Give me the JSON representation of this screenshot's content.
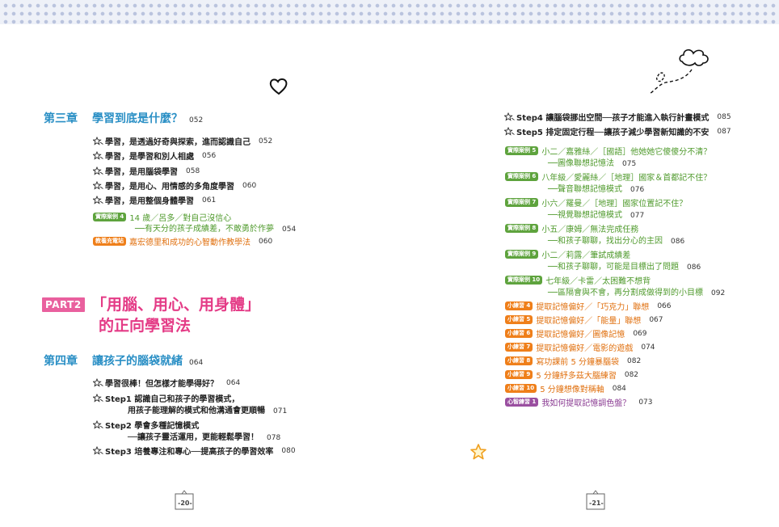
{
  "part": {
    "badge": "PART2",
    "title_line1": "「用腦、用心、用身體」",
    "title_line2": "的正向學習法"
  },
  "ch3": {
    "num": "第三章",
    "title": "學習到底是什麼？",
    "page": "052",
    "items": [
      {
        "text": "學習，是透過好奇與探索，進而認識自己",
        "page": "052"
      },
      {
        "text": "學習，是學習和別人相處",
        "page": "056"
      },
      {
        "text": "學習，是用腦袋學習",
        "page": "058"
      },
      {
        "text": "學習，是用心、用情感的多角度學習",
        "page": "060"
      },
      {
        "text": "學習，是用整個身體學習",
        "page": "061"
      }
    ],
    "case4": {
      "tag": "實際案例 4",
      "title": "14 歲／呂多／對自己沒信心",
      "sub": "──有天分的孩子成績差，不敢勇於作夢",
      "page": "054"
    },
    "parent": {
      "tag": "教養充電站",
      "title": "嘉宏德里和成功的心智動作教學法",
      "page": "060"
    }
  },
  "ch4": {
    "num": "第四章",
    "title": "讓孩子的腦袋就緒",
    "page": "064",
    "items": [
      {
        "text": "學習很棒！但怎樣才能學得好？",
        "page": "064"
      },
      {
        "text": "Step1 認識自己和孩子的學習模式，",
        "sub": "用孩子能理解的模式和他溝通會更順暢",
        "page": "071"
      },
      {
        "text": "Step2 學會多種記憶模式",
        "sub": "──讓孩子靈活運用，更能輕鬆學習！",
        "page": "078"
      },
      {
        "text": "Step3 培養專注和專心──提高孩子的學習效率",
        "page": "080"
      }
    ]
  },
  "right": {
    "steps": [
      {
        "text": "Step4 讓腦袋挪出空間──孩子才能進入執行計畫模式",
        "page": "085"
      },
      {
        "text": "Step5 排定固定行程──讓孩子減少學習新知識的不安",
        "page": "087"
      }
    ],
    "cases": [
      {
        "tag": "實際案例 5",
        "title": "小二／嘉雅絲／［國語］他她她它傻傻分不清？",
        "sub": "──圖像聯想記憶法",
        "page": "075"
      },
      {
        "tag": "實際案例 6",
        "title": "八年級／愛麗絲／［地理］國家＆首都記不住？",
        "sub": "──聲音聯想記憶模式",
        "page": "076"
      },
      {
        "tag": "實際案例 7",
        "title": "小六／羅曼／［地理］國家位置記不住？",
        "sub": "──視覺聯想記憶模式",
        "page": "077"
      },
      {
        "tag": "實際案例 8",
        "title": "小五／康姆／無法完成任務",
        "sub": "──和孩子聊聊，找出分心的主因",
        "page": "086"
      },
      {
        "tag": "實際案例 9",
        "title": "小二／莉露／筆試成績差",
        "sub": "──和孩子聊聊，可能是目標出了問題",
        "page": "086"
      },
      {
        "tag": "實際案例 10",
        "title": "七年級／卡雷／太困難不想背",
        "sub": "──區隔會與不會，再分割成做得到的小目標",
        "page": "092"
      }
    ],
    "exercises": [
      {
        "tag": "小練習 4",
        "text": "提取記憶偏好／「巧克力」聯想",
        "page": "066",
        "color": "orange"
      },
      {
        "tag": "小練習 5",
        "text": "提取記憶偏好／「能量」聯想",
        "page": "067",
        "color": "orange"
      },
      {
        "tag": "小練習 6",
        "text": "提取記憶偏好／圖像記憶",
        "page": "069",
        "color": "orange"
      },
      {
        "tag": "小練習 7",
        "text": "提取記憶偏好／電影的遊戲",
        "page": "074",
        "color": "orange"
      },
      {
        "tag": "小練習 8",
        "text": "寫功課前 5 分鐘暴腦袋",
        "page": "082",
        "color": "orange"
      },
      {
        "tag": "小練習 9",
        "text": "5 分鐘紓多茲大腦練習",
        "page": "082",
        "color": "orange"
      },
      {
        "tag": "小練習 10",
        "text": "5 分鐘想像對稱軸",
        "page": "084",
        "color": "orange"
      },
      {
        "tag": "心智練習 1",
        "text": "我如何提取記憶調色盤？",
        "page": "073",
        "color": "purple"
      }
    ]
  },
  "pages": {
    "left": "-20-",
    "right": "-21-"
  },
  "colors": {
    "chapter": "#2a8fc5",
    "part": "#e43b86",
    "case": "#5ea33d",
    "exercise": "#ef7f1a",
    "mind": "#9a4fa0"
  }
}
